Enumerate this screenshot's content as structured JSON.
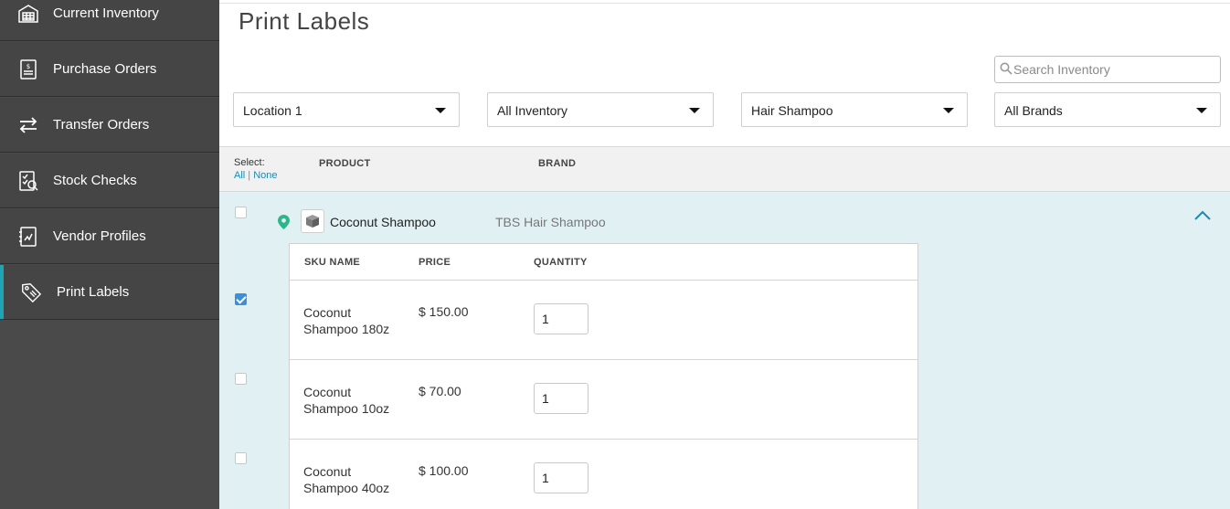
{
  "sidebar": {
    "items": [
      {
        "label": "Current Inventory",
        "icon": "inventory-table-icon"
      },
      {
        "label": "Purchase Orders",
        "icon": "purchase-order-icon"
      },
      {
        "label": "Transfer Orders",
        "icon": "transfer-arrows-icon"
      },
      {
        "label": "Stock Checks",
        "icon": "stock-check-icon"
      },
      {
        "label": "Vendor Profiles",
        "icon": "vendor-profile-icon"
      },
      {
        "label": "Print Labels",
        "icon": "tag-label-icon",
        "active": true
      }
    ]
  },
  "page": {
    "title": "Print Labels"
  },
  "search": {
    "placeholder": "Search Inventory",
    "icon": "search-icon"
  },
  "filters": {
    "location": "Location 1",
    "inventory": "All Inventory",
    "category": "Hair Shampoo",
    "brand": "All Brands"
  },
  "table": {
    "select_label": "Select:",
    "select_all": "All",
    "select_separator": "|",
    "select_none": "None",
    "col_product": "PRODUCT",
    "col_brand": "BRAND"
  },
  "product_group": {
    "name": "Coconut Shampoo",
    "brand": "TBS Hair Shampoo",
    "expanded": true,
    "checked": false,
    "sku_headers": {
      "name": "SKU NAME",
      "price": "PRICE",
      "quantity": "QUANTITY"
    },
    "skus": [
      {
        "name": "Coconut Shampoo 180z",
        "price": "$ 150.00",
        "quantity": "1",
        "checked": true
      },
      {
        "name": "Coconut Shampoo 10oz",
        "price": "$ 70.00",
        "quantity": "1",
        "checked": false
      },
      {
        "name": "Coconut Shampoo 40oz",
        "price": "$ 100.00",
        "quantity": "1",
        "checked": false
      }
    ]
  },
  "colors": {
    "sidebar_bg": "#4a4a4a",
    "active_accent": "#1fa4b6",
    "group_bg": "#e1f0f3",
    "checkbox_checked": "#3b8fe0",
    "link": "#1a8cb0"
  }
}
